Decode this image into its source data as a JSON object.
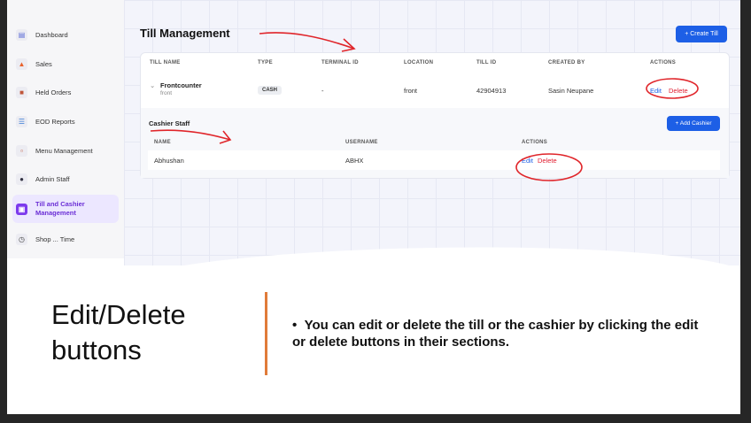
{
  "sidebar": {
    "items": [
      {
        "label": "Dashboard",
        "icon": "chart-icon"
      },
      {
        "label": "Sales",
        "icon": "fire-icon"
      },
      {
        "label": "Held Orders",
        "icon": "box-icon"
      },
      {
        "label": "EOD Reports",
        "icon": "report-icon"
      },
      {
        "label": "Menu Management",
        "icon": "menu-icon"
      },
      {
        "label": "Admin Staff",
        "icon": "users-icon"
      },
      {
        "label": "Till and Cashier Management",
        "icon": "register-icon"
      },
      {
        "label": "Shop ... Time",
        "icon": "clock-icon"
      }
    ]
  },
  "page": {
    "title": "Till Management",
    "create_label": "+ Create Till"
  },
  "till_table": {
    "headers": [
      "TILL NAME",
      "TYPE",
      "TERMINAL ID",
      "LOCATION",
      "TILL ID",
      "CREATED BY",
      "ACTIONS"
    ],
    "row": {
      "name": "Frontcounter",
      "sub": "front",
      "type": "CASH",
      "terminal_id": "-",
      "location": "front",
      "till_id": "42904913",
      "created_by": "Sasin Neupane",
      "edit": "Edit",
      "delete": "Delete"
    }
  },
  "cashier": {
    "title": "Cashier Staff",
    "add_label": "+ Add Cashier",
    "headers": [
      "NAME",
      "USERNAME",
      "ACTIONS"
    ],
    "row": {
      "name": "Abhushan",
      "username": "ABHX",
      "edit": "Edit",
      "delete": "Delete"
    }
  },
  "slide": {
    "heading": "Edit/Delete buttons",
    "bullet": "You can edit or delete the till or the cashier by clicking the edit or delete buttons in their sections."
  },
  "colors": {
    "accent": "#1d5fe6",
    "danger": "#e11d2f",
    "active": "#7c3aed",
    "divider": "#e07b39"
  }
}
